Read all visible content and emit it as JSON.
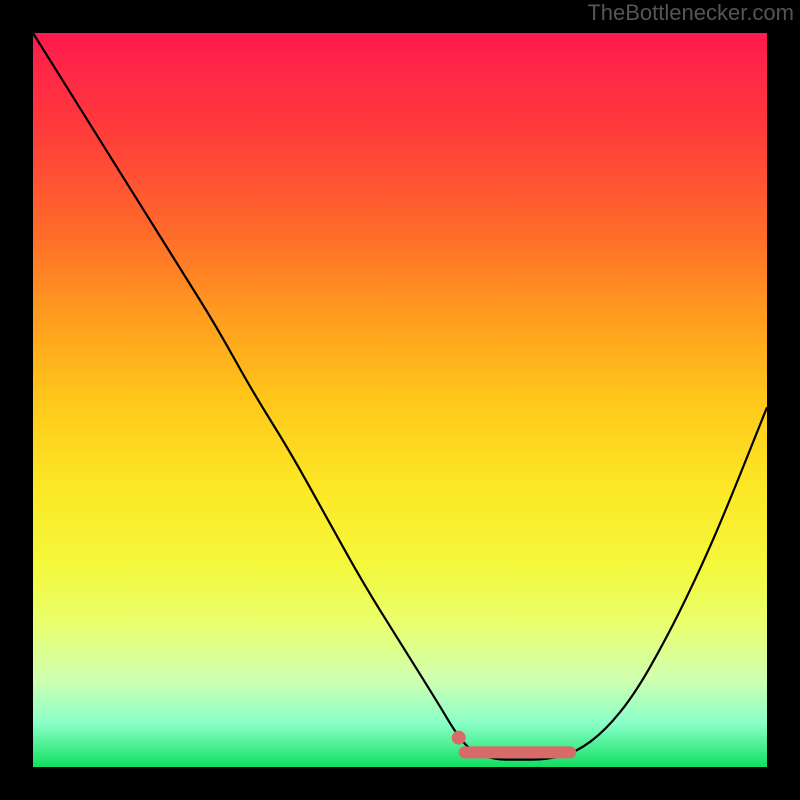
{
  "attribution": "TheBottlenecker.com",
  "chart_data": {
    "type": "line",
    "title": "",
    "xlabel": "",
    "ylabel": "",
    "xlim": [
      0,
      100
    ],
    "ylim": [
      0,
      100
    ],
    "series": [
      {
        "name": "bottleneck-curve",
        "x": [
          0,
          5,
          10,
          15,
          20,
          25,
          30,
          35,
          40,
          45,
          50,
          55,
          58,
          60,
          63,
          66,
          70,
          74,
          78,
          82,
          86,
          90,
          94,
          100
        ],
        "y": [
          100,
          92,
          84,
          76,
          68,
          60,
          51,
          43,
          34,
          25,
          17,
          9,
          4,
          2,
          1,
          1,
          1,
          2,
          5,
          10,
          17,
          25,
          34,
          49
        ]
      },
      {
        "name": "optimal-marker-dot",
        "x": [
          58
        ],
        "y": [
          4
        ]
      },
      {
        "name": "optimal-range-bar",
        "x": [
          58,
          74
        ],
        "y": [
          2,
          2
        ]
      }
    ],
    "colors": {
      "curve": "#000000",
      "marker": "#d86a6a",
      "bar": "#d86a6a"
    }
  }
}
